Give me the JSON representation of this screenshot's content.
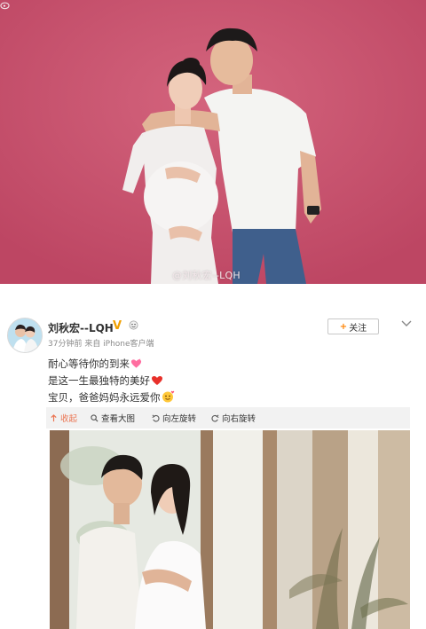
{
  "top_photo": {
    "watermark": "@刘秋宏--LQH"
  },
  "post": {
    "username": "刘秋宏--LQH",
    "verified_mark": "V",
    "meta": "37分钟前 来自 iPhone客户端",
    "follow_label": "关注",
    "lines": [
      "耐心等待你的到来",
      "是这一生最独特的美好",
      "宝贝，爸爸妈妈永远爱你"
    ]
  },
  "toolbar": {
    "collapse": "收起",
    "view_large": "查看大图",
    "rotate_left": "向左旋转",
    "rotate_right": "向右旋转"
  },
  "colors": {
    "accent": "#ff8200",
    "link": "#eb7350",
    "backdrop": "#c74d6a"
  },
  "icons": [
    "weibo-icon",
    "verified-v-icon",
    "emoji-icon",
    "chevron-down-icon",
    "heart-icon",
    "collapse-icon",
    "magnifier-icon",
    "rotate-left-icon",
    "rotate-right-icon"
  ]
}
